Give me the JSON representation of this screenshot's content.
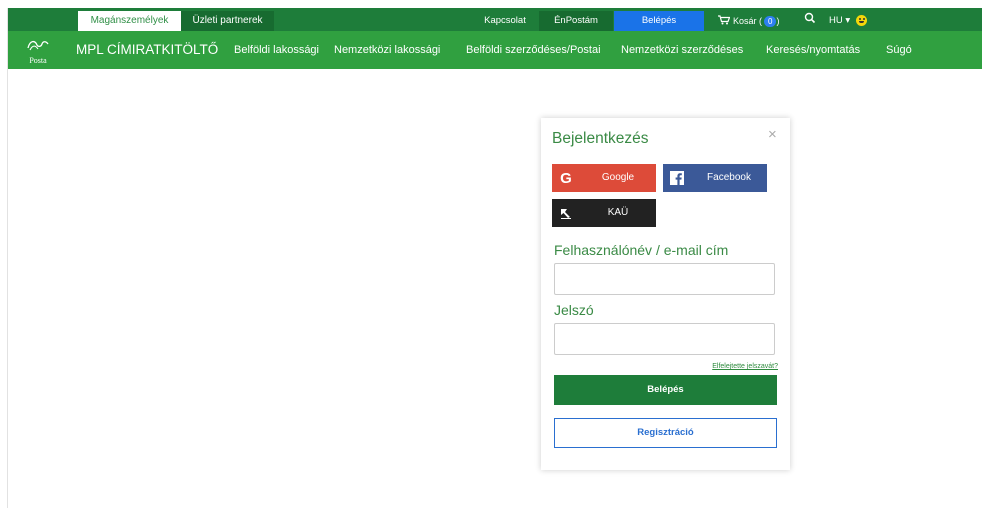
{
  "topbar": {
    "tabs": [
      {
        "label": "Magánszemélyek",
        "active": true
      },
      {
        "label": "Üzleti partnerek",
        "active": false
      }
    ],
    "links": {
      "kapcsolat": "Kapcsolat",
      "enpostam": "ÉnPostám",
      "belepes": "Belépés"
    },
    "cart": {
      "label": "Kosár (",
      "count": "0",
      "close": ")"
    },
    "language": "HU ▾",
    "colors": {
      "dark_green": "#1e7d3a",
      "login_blue": "#1a73e8"
    }
  },
  "nav": {
    "logo_text": "Posta",
    "brand": "MPL CÍMIRATKITÖLTŐ",
    "items": [
      "Belföldi lakossági",
      "Nemzetközi lakossági",
      "Belföldi szerződéses/Postai",
      "Nemzetközi szerződéses",
      "Keresés/nyomtatás",
      "Súgó"
    ],
    "background": "#30a040"
  },
  "login": {
    "title": "Bejelentkezés",
    "close": "×",
    "google": "Google",
    "google_letter": "G",
    "facebook": "Facebook",
    "kau": "KAÜ",
    "username_label": "Felhasználónév / e-mail cím",
    "username_value": "",
    "password_label": "Jelszó",
    "password_value": "",
    "forgot": "Elfelejtette jelszavát?",
    "submit": "Belépés",
    "register": "Regisztráció",
    "colors": {
      "google": "#dd4b39",
      "facebook": "#3b5998",
      "kau": "#222222",
      "submit": "#1e7d3a",
      "register": "#2a6fd0"
    }
  }
}
